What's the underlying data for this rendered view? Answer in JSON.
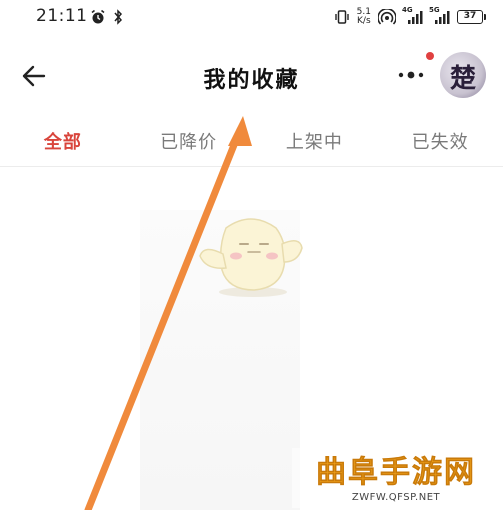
{
  "status_bar": {
    "time": "21:11",
    "net_speed_value": "5.1",
    "net_speed_unit": "K/s",
    "signal_1_label": "4G",
    "signal_2_label": "5G",
    "battery_level": "37"
  },
  "header": {
    "title": "我的收藏"
  },
  "tabs": [
    {
      "label": "全部",
      "active": true
    },
    {
      "label": "已降价",
      "active": false
    },
    {
      "label": "上架中",
      "active": false
    },
    {
      "label": "已失效",
      "active": false
    }
  ],
  "avatar": {
    "glyph": "楚"
  },
  "watermark": {
    "brand": "曲阜手游网",
    "url": "ZWFW.QFSP.NET"
  },
  "colors": {
    "accent": "#d9453c",
    "arrow": "#f08a3c",
    "watermark_text": "#f0a21a"
  }
}
